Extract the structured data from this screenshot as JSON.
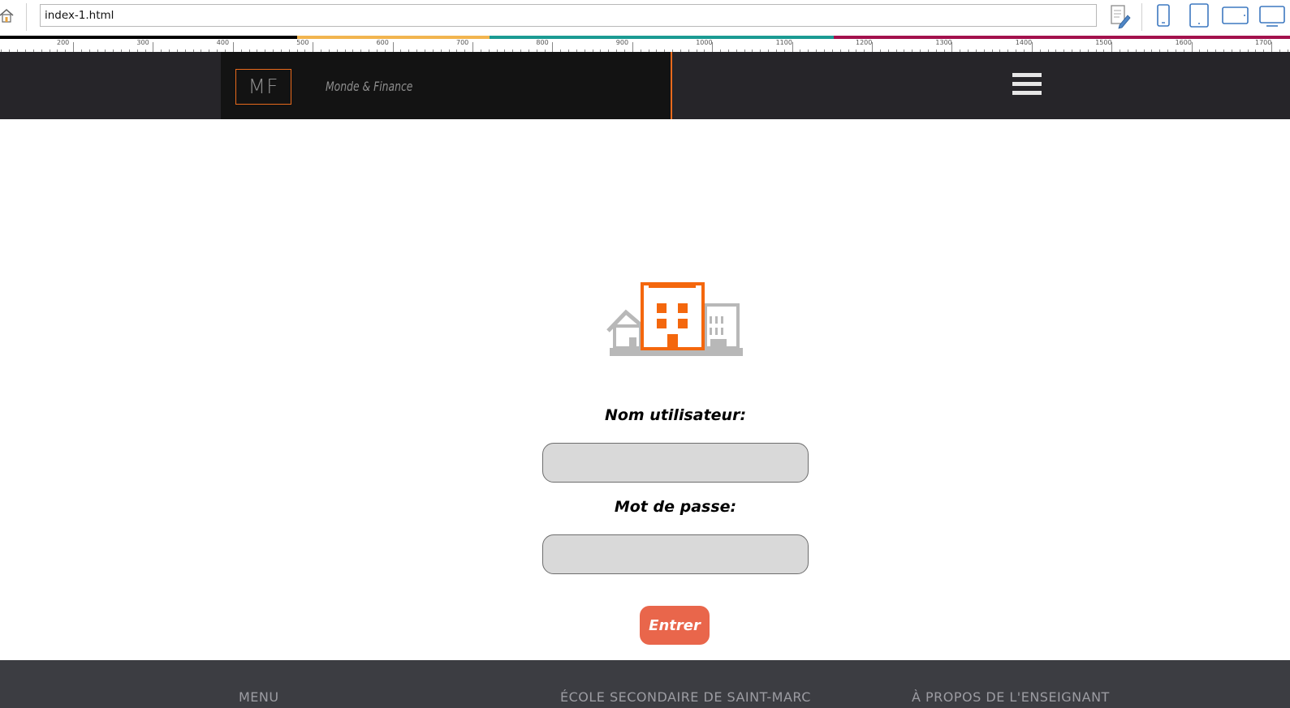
{
  "browser": {
    "url": "index-1.html",
    "icons": [
      "home-icon",
      "page-edit-icon",
      "phone-portrait-icon",
      "tablet-portrait-icon",
      "tablet-landscape-icon",
      "desktop-icon"
    ]
  },
  "ruler": {
    "labels": [
      "200",
      "300",
      "400",
      "500",
      "600",
      "700",
      "800",
      "900",
      "1000",
      "1100",
      "1200",
      "1300",
      "1400",
      "1500",
      "1600",
      "1700"
    ],
    "colors": [
      "#000000",
      "#f2b54f",
      "#1b9b93",
      "#a3114d"
    ]
  },
  "header": {
    "logo": "MF",
    "brand_name": "Monde & Finance",
    "menu_icon": "hamburger-menu-icon",
    "accent_color": "#e86a1c"
  },
  "login": {
    "icon": "buildings-icon",
    "username_label": "Nom utilisateur:",
    "username_value": "",
    "password_label": "Mot de passe:",
    "password_value": "",
    "submit_label": "Entrer",
    "submit_color": "#e9664b"
  },
  "footer": {
    "headings": [
      "MENU",
      "ÉCOLE SECONDAIRE DE SAINT-MARC",
      "À PROPOS DE L'ENSEIGNANT"
    ]
  }
}
